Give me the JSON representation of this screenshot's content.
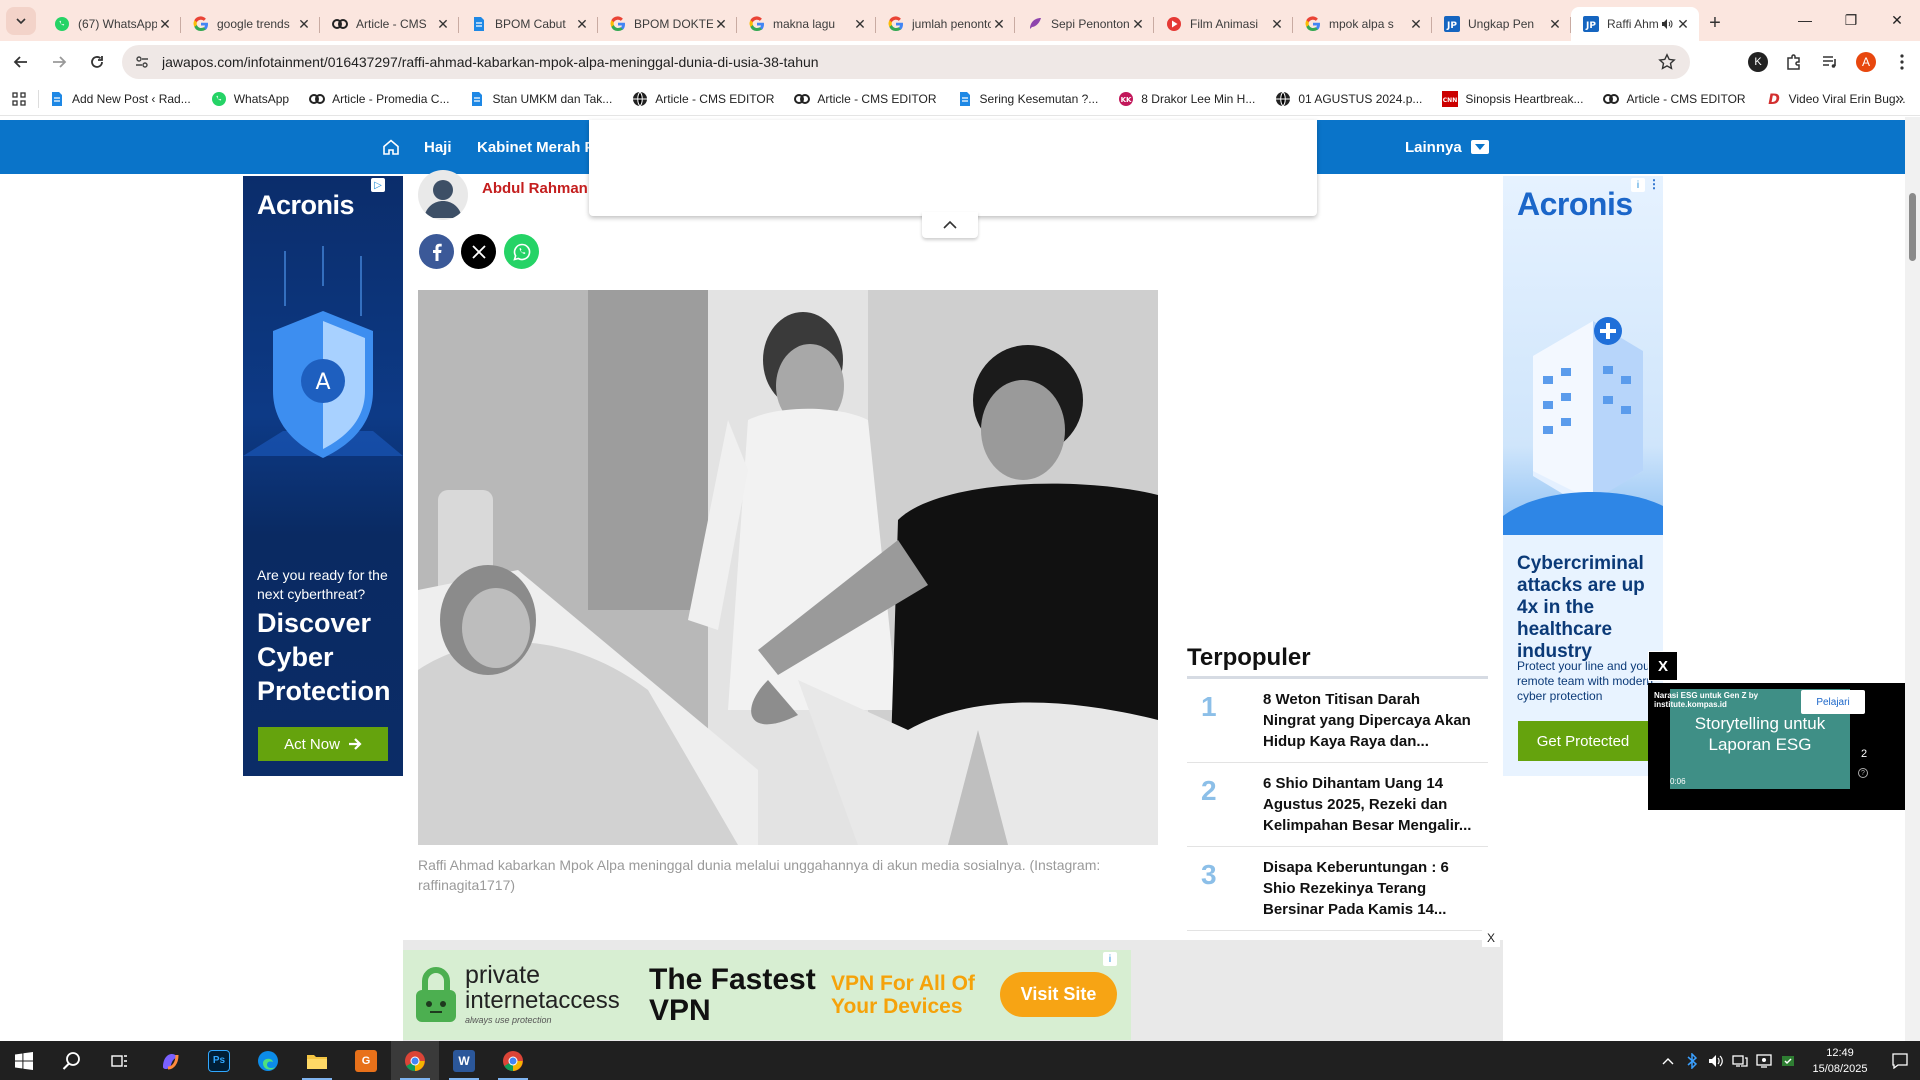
{
  "browser": {
    "tabs": [
      {
        "title": "(67) WhatsApp",
        "icon": "whatsapp-icon",
        "color": "#25d366"
      },
      {
        "title": "google trends",
        "icon": "google-icon",
        "color": "#4285f4"
      },
      {
        "title": "Article - CMS",
        "icon": "promedia-icon",
        "color": "#222222"
      },
      {
        "title": "BPOM Cabut",
        "icon": "doc-icon",
        "color": "#1e88e5"
      },
      {
        "title": "BPOM DOKTER",
        "icon": "google-icon",
        "color": "#4285f4"
      },
      {
        "title": "makna lagu",
        "icon": "google-icon",
        "color": "#4285f4"
      },
      {
        "title": "jumlah penonton",
        "icon": "google-icon",
        "color": "#4285f4"
      },
      {
        "title": "Sepi Penonton",
        "icon": "feather-icon",
        "color": "#8e44ad"
      },
      {
        "title": "Film Animasi",
        "icon": "film-icon",
        "color": "#e53935"
      },
      {
        "title": "mpok alpa s",
        "icon": "google-icon",
        "color": "#4285f4"
      },
      {
        "title": "Ungkap Pen",
        "icon": "jp-icon",
        "color": "#1565c0"
      },
      {
        "title": "Raffi Ahmad",
        "icon": "jp-icon",
        "color": "#1565c0",
        "active": true
      }
    ],
    "url": "jawapos.com/infotainment/016437297/raffi-ahmad-kabarkan-mpok-alpa-meninggal-dunia-di-usia-38-tahun",
    "profile_initial": "K",
    "account_initial": "A",
    "bookmarks": [
      {
        "label": "Add New Post ‹ Rad...",
        "icon": "doc-icon",
        "color": "#1e88e5"
      },
      {
        "label": "WhatsApp",
        "icon": "whatsapp-icon",
        "color": "#25d366"
      },
      {
        "label": "Article - Promedia C...",
        "icon": "promedia-icon",
        "color": "#222222"
      },
      {
        "label": "Stan UMKM dan Tak...",
        "icon": "doc-icon",
        "color": "#1e88e5"
      },
      {
        "label": "Article - CMS EDITOR",
        "icon": "globe-icon",
        "color": "#222222"
      },
      {
        "label": "Article - CMS EDITOR",
        "icon": "promedia-icon",
        "color": "#222222"
      },
      {
        "label": "Sering Kesemutan ?...",
        "icon": "doc-icon",
        "color": "#1e88e5"
      },
      {
        "label": "8 Drakor Lee Min H...",
        "icon": "kk-icon",
        "color": "#c2185b"
      },
      {
        "label": "01 AGUSTUS 2024.p...",
        "icon": "globe-icon",
        "color": "#222222"
      },
      {
        "label": "Sinopsis Heartbreak...",
        "icon": "cnn-icon",
        "color": "#cc0000"
      },
      {
        "label": "Article - CMS EDITOR",
        "icon": "promedia-icon",
        "color": "#222222"
      },
      {
        "label": "Video Viral Erin Bug...",
        "icon": "d-icon",
        "color": "#d32f2f"
      }
    ]
  },
  "site": {
    "nav": {
      "items": [
        "Haji",
        "Kabinet Merah P"
      ],
      "more_label": "Lainnya",
      "color": "#0a74c9"
    },
    "author": "Abdul Rahman",
    "image_caption": "Raffi Ahmad kabarkan Mpok Alpa meninggal dunia melalui unggahannya di akun media sosialnya. (Instagram: raffinagita1717)",
    "popular": {
      "title": "Terpopuler",
      "items": [
        {
          "num": "1",
          "title": "8 Weton Titisan Darah Ningrat yang Dipercaya Akan Hidup Kaya Raya dan..."
        },
        {
          "num": "2",
          "title": "6 Shio Dihantam Uang 14 Agustus 2025, Rezeki dan Kelimpahan Besar Mengalir..."
        },
        {
          "num": "3",
          "title": "Disapa Keberuntungan : 6 Shio Rezekinya Terang Bersinar Pada Kamis 14..."
        }
      ]
    }
  },
  "ads": {
    "left": {
      "brand": "Acronis",
      "question": "Are you ready for the next cyberthreat?",
      "headline": "Discover Cyber Protection",
      "cta": "Act Now"
    },
    "right": {
      "brand": "Acronis",
      "headline": "Cybercriminal attacks are up 4x in the healthcare industry",
      "body": "Protect your line and your remote team with modern cyber protection",
      "cta": "Get Protected"
    },
    "video": {
      "close": "X",
      "source": "Narasi ESG untuk Gen Z by institute.kompas.id",
      "cta": "Pelajari",
      "caption": "Storytelling untuk Laporan ESG",
      "time": "0:06",
      "count": "2"
    },
    "bottom": {
      "close": "X",
      "brand_line1": "private",
      "brand_line2": "internetaccess",
      "tagline": "always use protection",
      "headline": "The Fastest VPN",
      "sub": "VPN For All Of Your Devices",
      "cta": "Visit Site"
    }
  },
  "taskbar": {
    "time": "12:49",
    "date": "15/08/2025"
  }
}
